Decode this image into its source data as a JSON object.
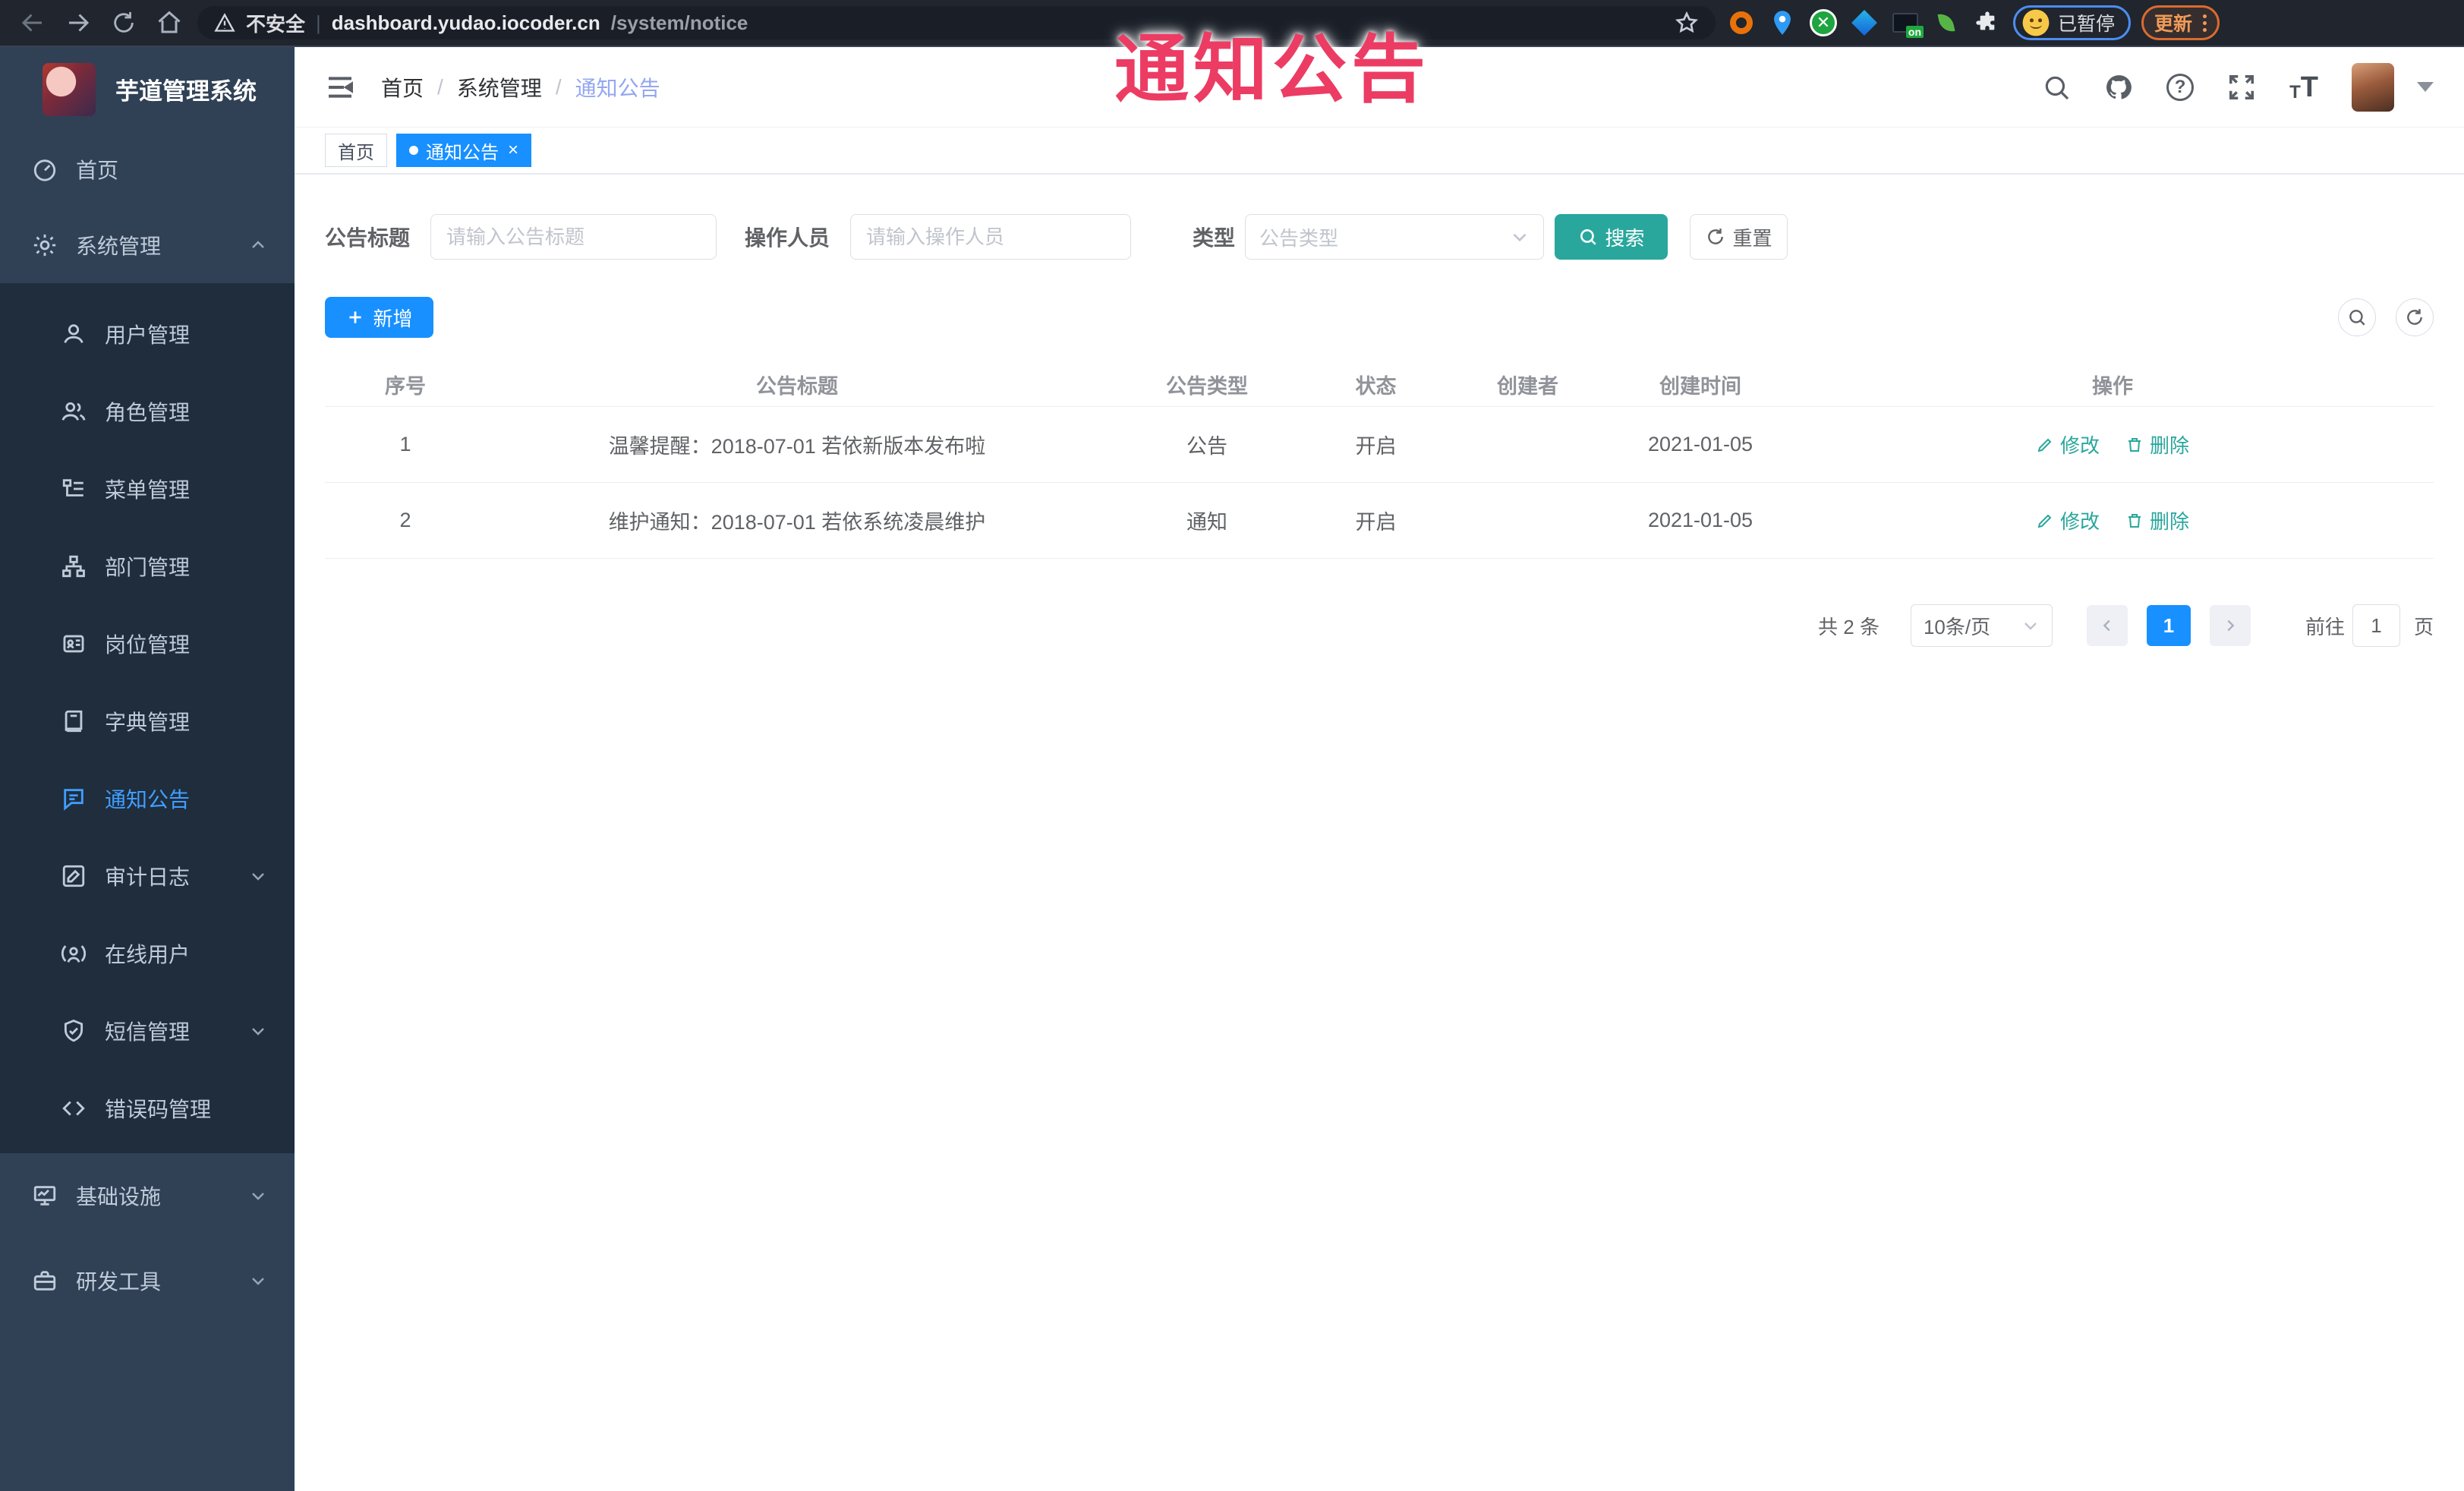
{
  "browser": {
    "security_label": "不安全",
    "url_host": "dashboard.yudao.iocoder.cn",
    "url_path": "/system/notice",
    "extension_badge": "on",
    "profile_label": "已暂停",
    "update_label": "更新"
  },
  "overlay": {
    "text": "通知公告",
    "color": "#ec3c63"
  },
  "sidebar": {
    "logo_title": "芋道管理系统",
    "items": [
      {
        "label": "首页",
        "icon": "dashboard-icon"
      },
      {
        "label": "系统管理",
        "icon": "gear-icon",
        "state": "expanded"
      },
      {
        "label": "用户管理",
        "icon": "user-icon"
      },
      {
        "label": "角色管理",
        "icon": "users-icon"
      },
      {
        "label": "菜单管理",
        "icon": "menu-tree-icon"
      },
      {
        "label": "部门管理",
        "icon": "sitemap-icon"
      },
      {
        "label": "岗位管理",
        "icon": "badge-icon"
      },
      {
        "label": "字典管理",
        "icon": "book-icon"
      },
      {
        "label": "通知公告",
        "icon": "message-icon",
        "state": "active"
      },
      {
        "label": "审计日志",
        "icon": "audit-icon",
        "state": "collapsed"
      },
      {
        "label": "在线用户",
        "icon": "online-user-icon"
      },
      {
        "label": "短信管理",
        "icon": "shield-icon",
        "state": "collapsed"
      },
      {
        "label": "错误码管理",
        "icon": "code-icon"
      },
      {
        "label": "基础设施",
        "icon": "infra-icon",
        "state": "collapsed"
      },
      {
        "label": "研发工具",
        "icon": "tools-icon",
        "state": "collapsed"
      }
    ]
  },
  "header": {
    "breadcrumb": [
      "首页",
      "系统管理",
      "通知公告"
    ],
    "separator": "/"
  },
  "tags": {
    "items": [
      {
        "label": "首页"
      },
      {
        "label": "通知公告",
        "active": true
      }
    ],
    "close_glyph": "×"
  },
  "filters": {
    "title_label": "公告标题",
    "title_placeholder": "请输入公告标题",
    "operator_label": "操作人员",
    "operator_placeholder": "请输入操作人员",
    "type_label": "类型",
    "type_placeholder": "公告类型",
    "search_label": "搜索",
    "reset_label": "重置"
  },
  "toolbar": {
    "add_label": "新增"
  },
  "table": {
    "headers": [
      "序号",
      "公告标题",
      "公告类型",
      "状态",
      "创建者",
      "创建时间",
      "操作"
    ],
    "rows": [
      {
        "index": "1",
        "title": "温馨提醒：2018-07-01 若依新版本发布啦",
        "type": "公告",
        "status": "开启",
        "creator": "",
        "created": "2021-01-05",
        "edit": "修改",
        "delete": "删除"
      },
      {
        "index": "2",
        "title": "维护通知：2018-07-01 若依系统凌晨维护",
        "type": "通知",
        "status": "开启",
        "creator": "",
        "created": "2021-01-05",
        "edit": "修改",
        "delete": "删除"
      }
    ]
  },
  "pagination": {
    "total": "共 2 条",
    "page_size": "10条/页",
    "current": "1",
    "goto_label": "前往",
    "goto_value": "1",
    "page_label": "页"
  },
  "colors": {
    "accent_blue": "#1890ff",
    "teal": "#29a79c",
    "sidebar_bg": "#304156",
    "submenu_bg": "#1f2d3d",
    "active_menu": "#409eff",
    "overlay_pink": "#ec3c63"
  }
}
